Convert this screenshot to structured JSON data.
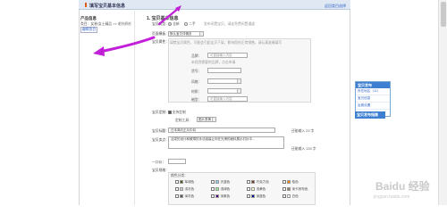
{
  "window": {
    "title": "填写宝贝基本信息",
    "back_link": "返回类目选择"
  },
  "sidebar": {
    "heading": "产品信息",
    "category_path": "类目：女装/女士精品 >> 毛针织衫",
    "edit_label": "编辑类目"
  },
  "section": {
    "title": "1. 宝贝基本信息"
  },
  "form": {
    "type_label": "宝贝类型：",
    "type_new": "全新",
    "type_used": "二手",
    "type_hint": "发布闲置宝贝，请走免费闲置通道",
    "template_label": "页面模板：",
    "template_value": "默认宝贝详情页",
    "attr_label": "宝贝属性：",
    "attr_hint": "填错宝贝属性，可能会引起宝贝下架，影响您的正常销售。请认真准确填写",
    "brand_label": "品牌：",
    "brand_placeholder": "可直接输入内容",
    "brand_hint": "未找到需要的品牌，点击申请",
    "item_label": "货号：",
    "style_label": "风格：",
    "sleeve_label": "材质：",
    "length_label": "袖型：",
    "length_placeholder": "可直接输入内容",
    "ship_label": "宝贝定制：",
    "ship_check": "支持定制",
    "tool_label": "定制工具：",
    "tool_value": "图片表情",
    "title_label": "宝贝标题：",
    "title_value": "日本简约正月中旬",
    "title_count": "还能输入 23 字",
    "desc_label": "宝贝卖点：",
    "desc_value": "活泼的设计和微薄的手法组装让你在光滑的面料展示衬衫中…",
    "desc_count": "还能输入 133 字",
    "price_label": "一口价：",
    "price_value": "",
    "sku_label": "宝贝规格：",
    "color_label": "颜色分类："
  },
  "colors": [
    {
      "name": "军绿色",
      "hex": "#4b5320"
    },
    {
      "name": "天蓝色",
      "hex": "#87ceeb"
    },
    {
      "name": "巧克力色",
      "hex": "#6b3a1e"
    },
    {
      "name": "桔色",
      "hex": "#ff8c00"
    },
    {
      "name": "浅灰色",
      "hex": "#cccccc"
    },
    {
      "name": "浅绿色",
      "hex": "#90ee90"
    },
    {
      "name": "浅黄色",
      "hex": "#fffacd"
    },
    {
      "name": "深卡其布色",
      "hex": "#8b7d5b"
    },
    {
      "name": "深灰色",
      "hex": "#555555"
    },
    {
      "name": "深紫色",
      "hex": "#4b0082"
    },
    {
      "name": "深蓝色",
      "hex": "#00008b"
    },
    {
      "name": "白色",
      "hex": "#ffffff"
    }
  ],
  "help_panel": {
    "head": "宝贝发布",
    "items": [
      "所在地区（11）",
      "宝贝信息",
      "运费设置",
      "其他信息"
    ],
    "button": "宝贝发布指南"
  },
  "watermark": {
    "text": "Baidu 经验",
    "sub": "jingyan.baidu.com"
  }
}
